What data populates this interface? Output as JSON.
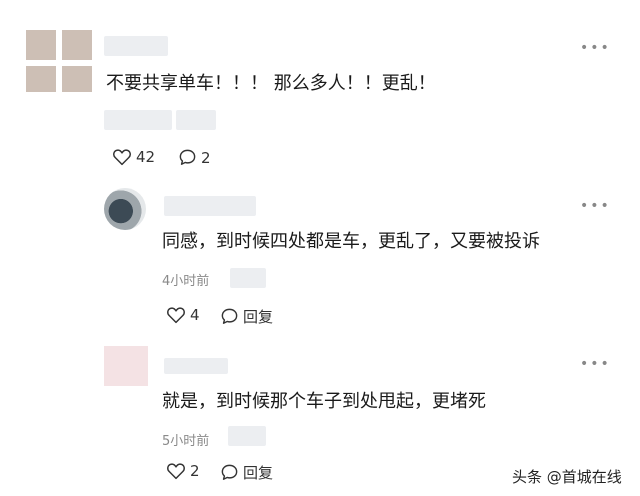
{
  "comments": [
    {
      "text": "不要共享单车！！！ 那么多人！！更乱！",
      "likes": "42",
      "replies": "2"
    },
    {
      "text": "同感，到时候四处都是车，更乱了，又要被投诉",
      "time": "4小时前",
      "likes": "4",
      "reply_label": "回复"
    },
    {
      "text": "就是，到时候那个车子到处甩起，更堵死",
      "time": "5小时前",
      "likes": "2",
      "reply_label": "回复"
    }
  ],
  "more_icon": "⋮",
  "watermark": "头条 @首城在线"
}
